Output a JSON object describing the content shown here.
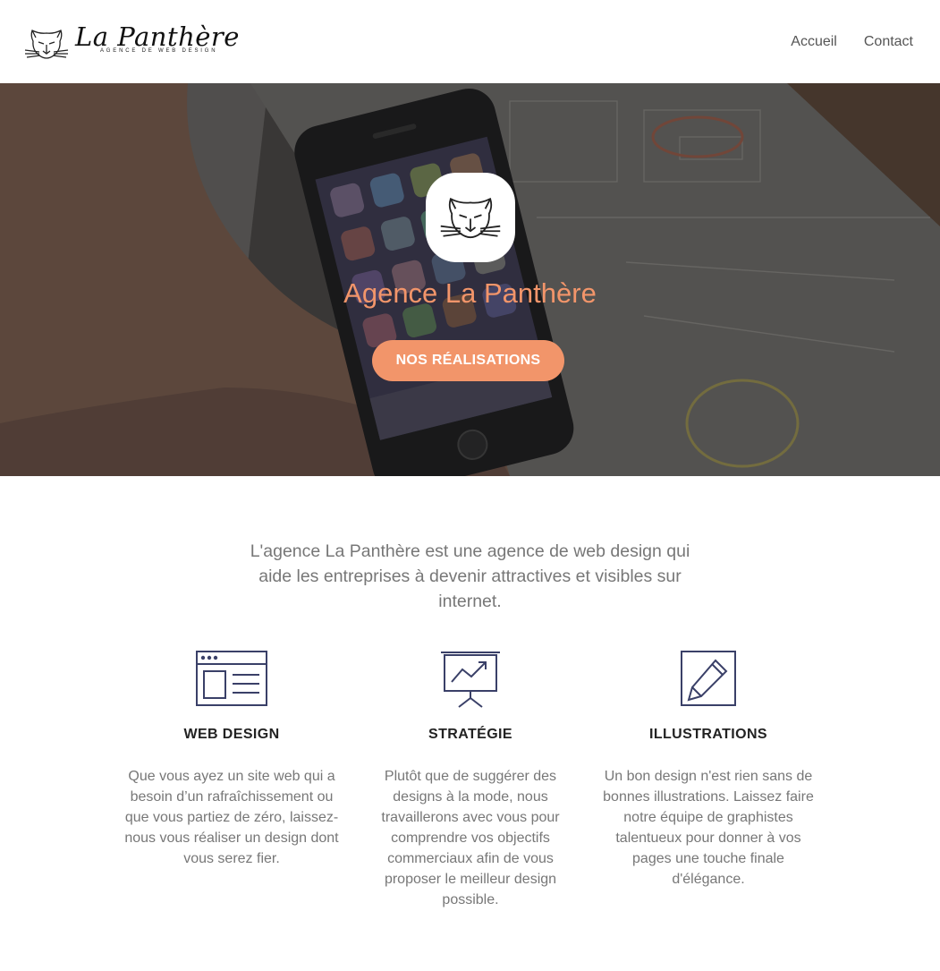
{
  "brand": {
    "name": "La Panthère",
    "tagline": "AGENCE DE WEB DESIGN"
  },
  "nav": [
    {
      "label": "Accueil"
    },
    {
      "label": "Contact"
    }
  ],
  "hero": {
    "title": "Agence La Panthère",
    "button_label": "NOS RÉALISATIONS"
  },
  "intro": "L'agence La Panthère est une agence de web design qui aide les entreprises à devenir attractives et visibles sur internet.",
  "services": [
    {
      "icon": "browser-window-icon",
      "title": "WEB DESIGN",
      "text": "Que vous ayez un site web qui a besoin d’un rafraîchissement ou que vous partiez de zéro, laissez-nous vous réaliser un design dont vous serez fier."
    },
    {
      "icon": "presentation-chart-icon",
      "title": "STRATÉGIE",
      "text": "Plutôt que de suggérer des designs à la mode, nous travaillerons avec vous pour comprendre vos objectifs commerciaux afin de vous proposer le meilleur design possible."
    },
    {
      "icon": "pencil-icon",
      "title": "ILLUSTRATIONS",
      "text": "Un bon design n'est rien sans de bonnes illustrations. Laissez faire notre équipe de graphistes talentueux pour donner à vos pages une touche finale d'élégance."
    }
  ],
  "colors": {
    "accent": "#f2956a",
    "icon": "#3a4068",
    "text": "#777777"
  }
}
